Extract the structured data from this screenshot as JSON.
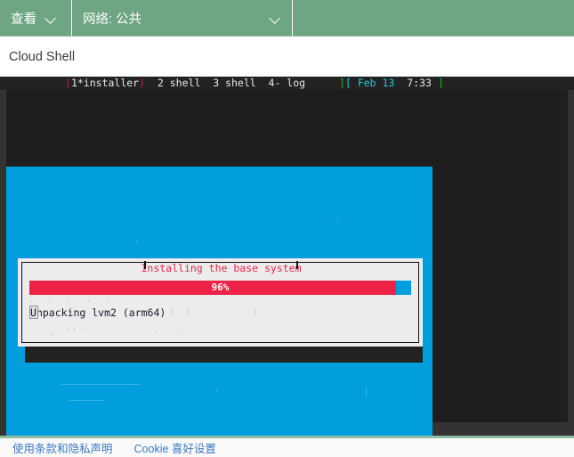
{
  "toolbar": {
    "view_label": "查看",
    "network_label": "网络: 公共",
    "chevron_icon": "chevron-down-icon"
  },
  "subheader": {
    "title": "Cloud Shell"
  },
  "terminal": {
    "status_bar": {
      "left_bracket": "[",
      "window_active": "(1*installer)",
      "window_active_open": "(",
      "window_active_name": "1*installer",
      "window_active_close": ")",
      "windows": "2 shell  3 shell  4- log",
      "right_close_bracket": "]",
      "right_open_bracket": "[",
      "date": "Feb 13",
      "time": "7:33",
      "right_bracket": "]"
    },
    "dialog": {
      "title": "Installing the base system",
      "progress_percent_label": "96%",
      "progress_percent": 96,
      "status_first_char": "U",
      "status_rest": "npacking lvm2 (arm64)",
      "status_text": "Unpacking lvm2 (arm64)"
    }
  },
  "footer": {
    "terms_link": "使用条款和隐私声明",
    "cookie_link": "Cookie 喜好设置"
  },
  "colors": {
    "toolbar_green": "#6ea583",
    "installer_blue": "#009edd",
    "progress_red": "#ee2247",
    "title_red": "#e8274b",
    "link_blue": "#3b78c2",
    "terminal_dark": "#1e1e1e"
  }
}
